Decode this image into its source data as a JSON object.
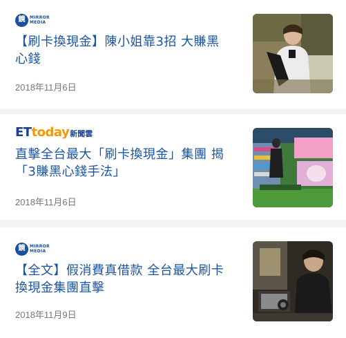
{
  "articles": [
    {
      "source": "Mirror Media",
      "source_badge": "鏡",
      "source_line1": "MIRROR",
      "source_line2": "MEDIA",
      "title_line1": "【刷卡換現金】陳小姐靠3招 大賺黑",
      "title_line2": "心錢",
      "date": "2018年11月6日",
      "thumbnail": "woman-at-counter-photo"
    },
    {
      "source": "ETtoday新聞雲",
      "logo_et": "ET",
      "logo_today": "today",
      "logo_cn": "新聞雲",
      "title_line1": "直擊全台最大「刷卡換現金」集團 揭",
      "title_line2": "「3賺黑心錢手法」",
      "date": "2018年11月6日",
      "thumbnail": "convenience-store-photo"
    },
    {
      "source": "Mirror Media",
      "source_badge": "鏡",
      "source_line1": "MIRROR",
      "source_line2": "MEDIA",
      "title_line1": "【全文】假消費真借款 全台最大刷卡",
      "title_line2": "換現金集團直擊",
      "date": "2018年11月9日",
      "thumbnail": "man-at-desk-photo"
    }
  ],
  "colors": {
    "title": "#1a55a5",
    "date": "#777777",
    "background": "#f1f3f4",
    "mirror_media_blue": "#1c4f9c",
    "ettoday_orange": "#f39800"
  }
}
